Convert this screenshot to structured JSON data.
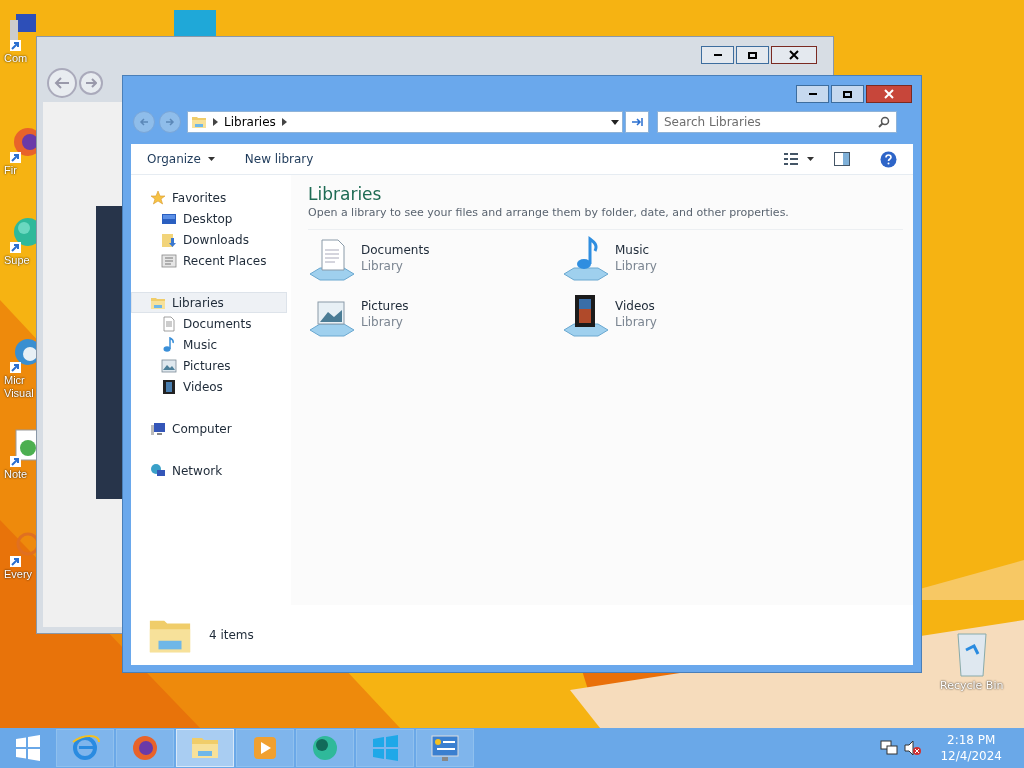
{
  "desktop_icons": [
    {
      "lines": [
        "Com"
      ],
      "kind": "computer"
    },
    {
      "lines": [
        "Fir"
      ],
      "kind": "firefox"
    },
    {
      "lines": [
        "Supe"
      ],
      "kind": "globe"
    },
    {
      "lines": [
        "Micr",
        "Visual"
      ],
      "kind": "edge"
    },
    {
      "lines": [
        "Note"
      ],
      "kind": "notepad"
    },
    {
      "lines": [
        "Every"
      ],
      "kind": "search"
    }
  ],
  "recycle_bin": {
    "label": "Recycle Bin"
  },
  "window": {
    "address": "Libraries",
    "search": {
      "placeholder": "Search Libraries"
    },
    "toolbar": [
      {
        "label": "Organize",
        "dropdown": true
      },
      {
        "label": "New library",
        "dropdown": false
      }
    ],
    "nav": [
      {
        "label": "Favorites",
        "kind": "star",
        "selected": false,
        "children": [
          {
            "label": "Desktop",
            "kind": "desktop"
          },
          {
            "label": "Downloads",
            "kind": "downloads"
          },
          {
            "label": "Recent Places",
            "kind": "recent"
          }
        ]
      },
      {
        "label": "Libraries",
        "kind": "libraries",
        "selected": true,
        "children": [
          {
            "label": "Documents",
            "kind": "documents"
          },
          {
            "label": "Music",
            "kind": "music"
          },
          {
            "label": "Pictures",
            "kind": "pictures"
          },
          {
            "label": "Videos",
            "kind": "videos"
          }
        ]
      },
      {
        "label": "Computer",
        "kind": "computer",
        "selected": false
      },
      {
        "label": "Network",
        "kind": "network",
        "selected": false
      }
    ],
    "heading": "Libraries",
    "subtitle": "Open a library to see your files and arrange them by folder, date, and other properties.",
    "items": [
      {
        "name": "Documents",
        "type": "Library",
        "kind": "documents"
      },
      {
        "name": "Music",
        "type": "Library",
        "kind": "music"
      },
      {
        "name": "Pictures",
        "type": "Library",
        "kind": "pictures"
      },
      {
        "name": "Videos",
        "type": "Library",
        "kind": "videos"
      }
    ],
    "status": "4 items"
  },
  "taskbar": {
    "apps": [
      {
        "kind": "ie",
        "selected": false
      },
      {
        "kind": "firefox",
        "selected": false
      },
      {
        "kind": "explorer",
        "selected": true
      },
      {
        "kind": "media",
        "selected": false
      },
      {
        "kind": "globe",
        "selected": false
      },
      {
        "kind": "windows",
        "selected": false
      },
      {
        "kind": "panel",
        "selected": false
      }
    ],
    "time": "2:18 PM",
    "date": "12/4/2024"
  }
}
